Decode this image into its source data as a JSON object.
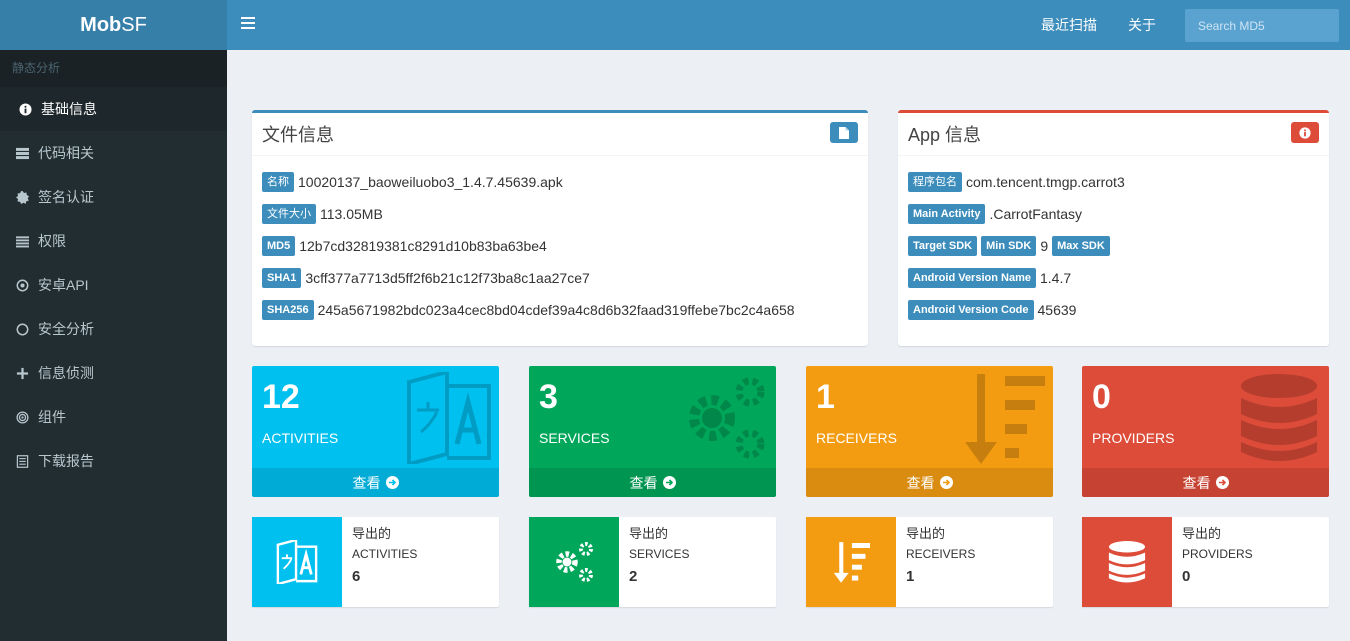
{
  "app": {
    "logo_bold": "Mob",
    "logo_light": "SF"
  },
  "sidebar": {
    "header": "静态分析",
    "items": [
      {
        "label": "基础信息",
        "icon": "info-circle-icon"
      },
      {
        "label": "代码相关",
        "icon": "server-icon"
      },
      {
        "label": "签名认证",
        "icon": "certificate-icon"
      },
      {
        "label": "权限",
        "icon": "list-icon"
      },
      {
        "label": "安卓API",
        "icon": "dot-circle-icon"
      },
      {
        "label": "安全分析",
        "icon": "circle-icon"
      },
      {
        "label": "信息侦测",
        "icon": "plus-icon"
      },
      {
        "label": "组件",
        "icon": "target-icon"
      },
      {
        "label": "下载报告",
        "icon": "document-icon"
      }
    ]
  },
  "header": {
    "recent_scans": "最近扫描",
    "about": "关于",
    "search_placeholder": "Search MD5"
  },
  "file_info": {
    "title": "文件信息",
    "rows": [
      {
        "label": "名称",
        "value": "10020137_baoweiluobo3_1.4.7.45639.apk"
      },
      {
        "label": "文件大小",
        "value": "113.05MB"
      },
      {
        "label": "MD5",
        "value": "12b7cd32819381c8291d10b83ba63be4"
      },
      {
        "label": "SHA1",
        "value": "3cff377a7713d5ff2f6b21c12f73ba8c1aa27ce7"
      },
      {
        "label": "SHA256",
        "value": "245a5671982bdc023a4cec8bd04cdef39a4c8d6b32faad319ffebe7bc2c4a658"
      }
    ]
  },
  "app_info": {
    "title": "App 信息",
    "package_label": "程序包名",
    "package_value": "com.tencent.tmgp.carrot3",
    "main_activity_label": "Main Activity",
    "main_activity_value": ".CarrotFantasy",
    "target_sdk_label": "Target SDK",
    "min_sdk_label": "Min SDK",
    "min_sdk_value": "9",
    "max_sdk_label": "Max SDK",
    "version_name_label": "Android Version Name",
    "version_name_value": "1.4.7",
    "version_code_label": "Android Version Code",
    "version_code_value": "45639"
  },
  "stats": [
    {
      "count": "12",
      "name": "ACTIVITIES",
      "link": "查看",
      "color": "#00c0ef",
      "icon": "translate-icon"
    },
    {
      "count": "3",
      "name": "SERVICES",
      "link": "查看",
      "color": "#00a65a",
      "icon": "gears-icon"
    },
    {
      "count": "1",
      "name": "RECEIVERS",
      "link": "查看",
      "color": "#f39c12",
      "icon": "sort-amount-down-icon"
    },
    {
      "count": "0",
      "name": "PROVIDERS",
      "link": "查看",
      "color": "#dd4b39",
      "icon": "database-icon"
    }
  ],
  "exported": [
    {
      "label": "导出的",
      "name": "ACTIVITIES",
      "count": "6",
      "color": "#00c0ef",
      "icon": "translate-icon"
    },
    {
      "label": "导出的",
      "name": "SERVICES",
      "count": "2",
      "color": "#00a65a",
      "icon": "gears-icon"
    },
    {
      "label": "导出的",
      "name": "RECEIVERS",
      "count": "1",
      "color": "#f39c12",
      "icon": "sort-amount-down-icon"
    },
    {
      "label": "导出的",
      "name": "PROVIDERS",
      "count": "0",
      "color": "#dd4b39",
      "icon": "database-icon"
    }
  ]
}
